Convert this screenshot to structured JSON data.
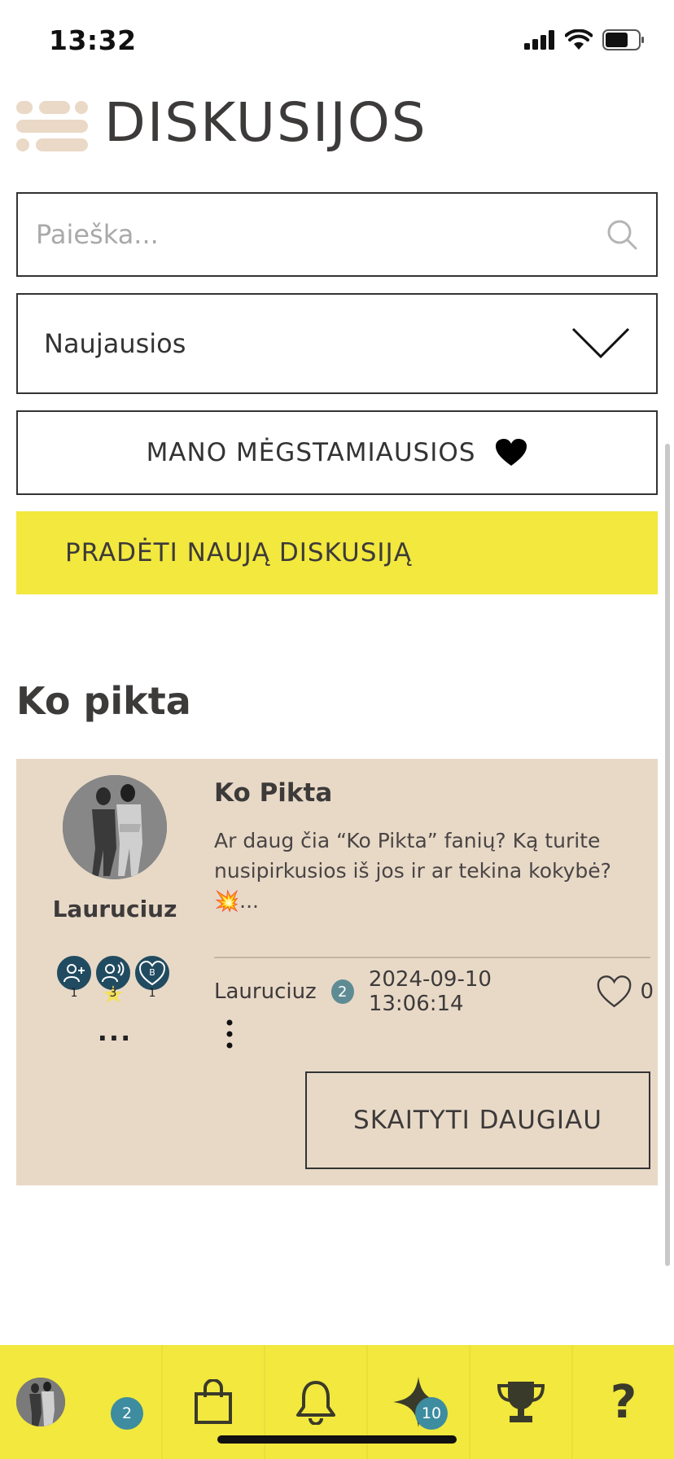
{
  "status_bar": {
    "time": "13:32"
  },
  "header": {
    "title": "DISKUSIJOS",
    "menu_icon": "hamburger-menu-icon"
  },
  "search": {
    "placeholder": "Paieška...",
    "value": ""
  },
  "sort": {
    "selected": "Naujausios"
  },
  "favorites": {
    "label": "MANO MĖGSTAMIAUSIOS"
  },
  "new_discussion": {
    "label": "PRADĖTI NAUJĄ DISKUSIJĄ"
  },
  "section": {
    "title": "Ko pikta"
  },
  "post": {
    "author": "Lauruciuz",
    "badges": [
      {
        "icon": "add-friend-badge-icon",
        "count": "1"
      },
      {
        "icon": "voice-badge-icon",
        "count": "3"
      },
      {
        "icon": "heart-b-badge-icon",
        "count": "1",
        "letter": "B"
      }
    ],
    "more": "...",
    "title": "Ko Pikta",
    "excerpt": "Ar daug čia “Ko Pikta” fanių? Ką turite nusipirkusios iš jos ir ar tekina kokybė? 💥...",
    "meta_author": "Lauruciuz",
    "meta_level": "2",
    "date": "2024-09-10 13:06:14",
    "likes": "0",
    "read_more": "SKAITYTI DAUGIAU"
  },
  "tabbar": {
    "profile_badge": "2",
    "stars_badge": "10",
    "help_label": "?",
    "accent": "#f2e83e"
  },
  "colors": {
    "yellow": "#f2e83e",
    "beige": "#e8d9c7",
    "menu": "#ead9c6",
    "teal": "#3d8ca0",
    "badge_dark": "#214b60"
  }
}
